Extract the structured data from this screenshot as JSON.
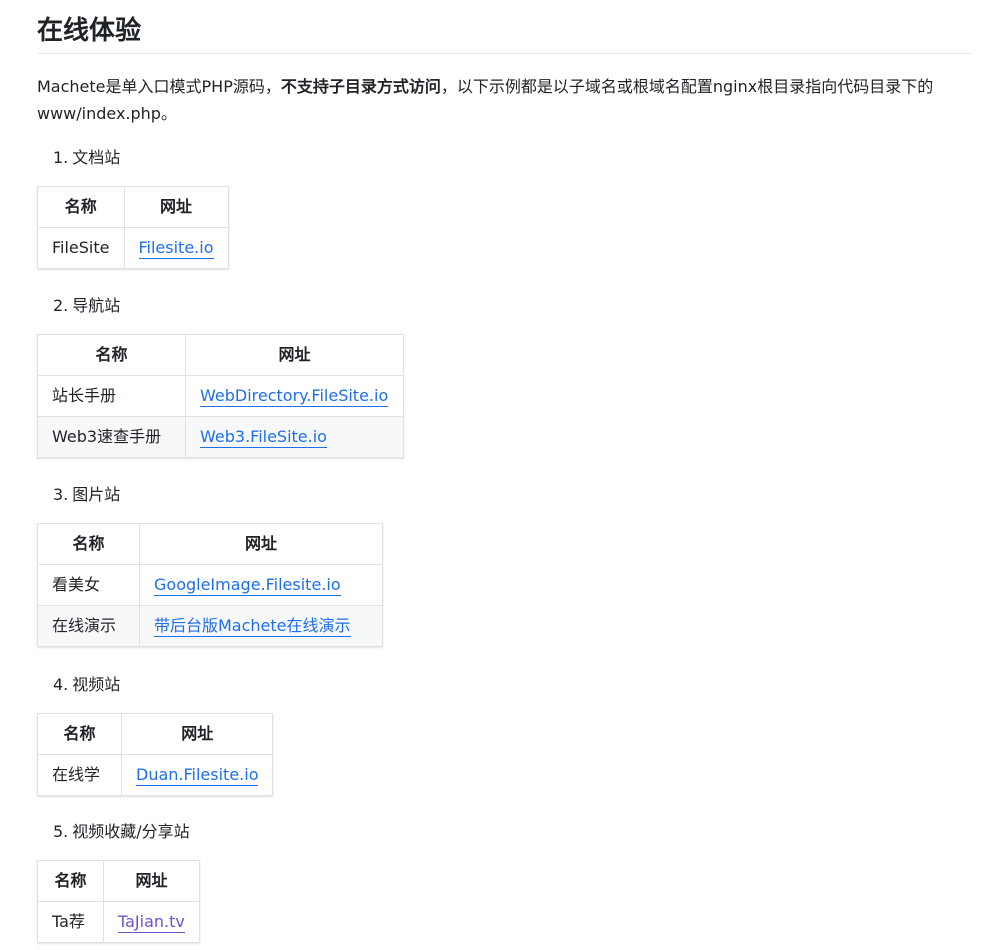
{
  "title": "在线体验",
  "intro": {
    "before": "Machete是单入口模式PHP源码，",
    "bold": "不支持子目录方式访问",
    "after": "，以下示例都是以子域名或根域名配置nginx根目录指向代码目录下的www/index.php。"
  },
  "sections": [
    {
      "num": "1.",
      "label": "文档站",
      "header_name": "名称",
      "header_url": "网址",
      "rows": [
        {
          "name": "FileSite",
          "url": "Filesite.io"
        }
      ]
    },
    {
      "num": "2.",
      "label": "导航站",
      "header_name": "名称",
      "header_url": "网址",
      "rows": [
        {
          "name": "站长手册",
          "url": "WebDirectory.FileSite.io"
        },
        {
          "name": "Web3速查手册",
          "url": "Web3.FileSite.io"
        }
      ]
    },
    {
      "num": "3.",
      "label": "图片站",
      "header_name": "名称",
      "header_url": "网址",
      "rows": [
        {
          "name": "看美女",
          "url": "GoogleImage.Filesite.io"
        },
        {
          "name": "在线演示",
          "url": "带后台版Machete在线演示"
        }
      ]
    },
    {
      "num": "4.",
      "label": "视频站",
      "header_name": "名称",
      "header_url": "网址",
      "rows": [
        {
          "name": "在线学",
          "url": "Duan.Filesite.io"
        }
      ]
    },
    {
      "num": "5.",
      "label": "视频收藏/分享站",
      "header_name": "名称",
      "header_url": "网址",
      "rows": [
        {
          "name": "Ta荐",
          "url": "TaJian.tv"
        }
      ]
    }
  ],
  "colors": {
    "link": "#1f6feb",
    "visited_link": "#6e54c4",
    "border": "#dfe2e5",
    "stripe": "#f7f8fa"
  }
}
